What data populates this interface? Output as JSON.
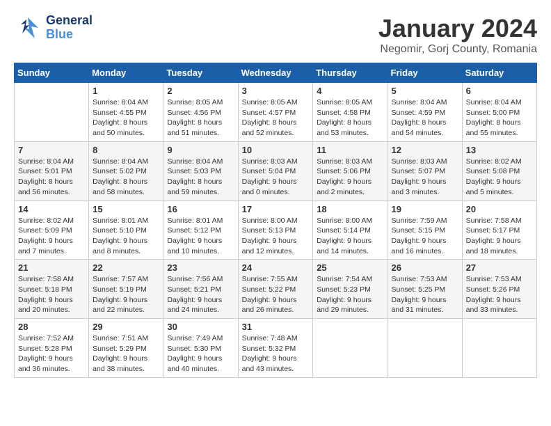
{
  "header": {
    "logo": {
      "general": "General",
      "blue": "Blue"
    },
    "title": "January 2024",
    "location": "Negomir, Gorj County, Romania"
  },
  "weekdays": [
    "Sunday",
    "Monday",
    "Tuesday",
    "Wednesday",
    "Thursday",
    "Friday",
    "Saturday"
  ],
  "weeks": [
    [
      {
        "day": "",
        "sunrise": "",
        "sunset": "",
        "daylight": ""
      },
      {
        "day": "1",
        "sunrise": "Sunrise: 8:04 AM",
        "sunset": "Sunset: 4:55 PM",
        "daylight": "Daylight: 8 hours and 50 minutes."
      },
      {
        "day": "2",
        "sunrise": "Sunrise: 8:05 AM",
        "sunset": "Sunset: 4:56 PM",
        "daylight": "Daylight: 8 hours and 51 minutes."
      },
      {
        "day": "3",
        "sunrise": "Sunrise: 8:05 AM",
        "sunset": "Sunset: 4:57 PM",
        "daylight": "Daylight: 8 hours and 52 minutes."
      },
      {
        "day": "4",
        "sunrise": "Sunrise: 8:05 AM",
        "sunset": "Sunset: 4:58 PM",
        "daylight": "Daylight: 8 hours and 53 minutes."
      },
      {
        "day": "5",
        "sunrise": "Sunrise: 8:04 AM",
        "sunset": "Sunset: 4:59 PM",
        "daylight": "Daylight: 8 hours and 54 minutes."
      },
      {
        "day": "6",
        "sunrise": "Sunrise: 8:04 AM",
        "sunset": "Sunset: 5:00 PM",
        "daylight": "Daylight: 8 hours and 55 minutes."
      }
    ],
    [
      {
        "day": "7",
        "sunrise": "Sunrise: 8:04 AM",
        "sunset": "Sunset: 5:01 PM",
        "daylight": "Daylight: 8 hours and 56 minutes."
      },
      {
        "day": "8",
        "sunrise": "Sunrise: 8:04 AM",
        "sunset": "Sunset: 5:02 PM",
        "daylight": "Daylight: 8 hours and 58 minutes."
      },
      {
        "day": "9",
        "sunrise": "Sunrise: 8:04 AM",
        "sunset": "Sunset: 5:03 PM",
        "daylight": "Daylight: 8 hours and 59 minutes."
      },
      {
        "day": "10",
        "sunrise": "Sunrise: 8:03 AM",
        "sunset": "Sunset: 5:04 PM",
        "daylight": "Daylight: 9 hours and 0 minutes."
      },
      {
        "day": "11",
        "sunrise": "Sunrise: 8:03 AM",
        "sunset": "Sunset: 5:06 PM",
        "daylight": "Daylight: 9 hours and 2 minutes."
      },
      {
        "day": "12",
        "sunrise": "Sunrise: 8:03 AM",
        "sunset": "Sunset: 5:07 PM",
        "daylight": "Daylight: 9 hours and 3 minutes."
      },
      {
        "day": "13",
        "sunrise": "Sunrise: 8:02 AM",
        "sunset": "Sunset: 5:08 PM",
        "daylight": "Daylight: 9 hours and 5 minutes."
      }
    ],
    [
      {
        "day": "14",
        "sunrise": "Sunrise: 8:02 AM",
        "sunset": "Sunset: 5:09 PM",
        "daylight": "Daylight: 9 hours and 7 minutes."
      },
      {
        "day": "15",
        "sunrise": "Sunrise: 8:01 AM",
        "sunset": "Sunset: 5:10 PM",
        "daylight": "Daylight: 9 hours and 8 minutes."
      },
      {
        "day": "16",
        "sunrise": "Sunrise: 8:01 AM",
        "sunset": "Sunset: 5:12 PM",
        "daylight": "Daylight: 9 hours and 10 minutes."
      },
      {
        "day": "17",
        "sunrise": "Sunrise: 8:00 AM",
        "sunset": "Sunset: 5:13 PM",
        "daylight": "Daylight: 9 hours and 12 minutes."
      },
      {
        "day": "18",
        "sunrise": "Sunrise: 8:00 AM",
        "sunset": "Sunset: 5:14 PM",
        "daylight": "Daylight: 9 hours and 14 minutes."
      },
      {
        "day": "19",
        "sunrise": "Sunrise: 7:59 AM",
        "sunset": "Sunset: 5:15 PM",
        "daylight": "Daylight: 9 hours and 16 minutes."
      },
      {
        "day": "20",
        "sunrise": "Sunrise: 7:58 AM",
        "sunset": "Sunset: 5:17 PM",
        "daylight": "Daylight: 9 hours and 18 minutes."
      }
    ],
    [
      {
        "day": "21",
        "sunrise": "Sunrise: 7:58 AM",
        "sunset": "Sunset: 5:18 PM",
        "daylight": "Daylight: 9 hours and 20 minutes."
      },
      {
        "day": "22",
        "sunrise": "Sunrise: 7:57 AM",
        "sunset": "Sunset: 5:19 PM",
        "daylight": "Daylight: 9 hours and 22 minutes."
      },
      {
        "day": "23",
        "sunrise": "Sunrise: 7:56 AM",
        "sunset": "Sunset: 5:21 PM",
        "daylight": "Daylight: 9 hours and 24 minutes."
      },
      {
        "day": "24",
        "sunrise": "Sunrise: 7:55 AM",
        "sunset": "Sunset: 5:22 PM",
        "daylight": "Daylight: 9 hours and 26 minutes."
      },
      {
        "day": "25",
        "sunrise": "Sunrise: 7:54 AM",
        "sunset": "Sunset: 5:23 PM",
        "daylight": "Daylight: 9 hours and 29 minutes."
      },
      {
        "day": "26",
        "sunrise": "Sunrise: 7:53 AM",
        "sunset": "Sunset: 5:25 PM",
        "daylight": "Daylight: 9 hours and 31 minutes."
      },
      {
        "day": "27",
        "sunrise": "Sunrise: 7:53 AM",
        "sunset": "Sunset: 5:26 PM",
        "daylight": "Daylight: 9 hours and 33 minutes."
      }
    ],
    [
      {
        "day": "28",
        "sunrise": "Sunrise: 7:52 AM",
        "sunset": "Sunset: 5:28 PM",
        "daylight": "Daylight: 9 hours and 36 minutes."
      },
      {
        "day": "29",
        "sunrise": "Sunrise: 7:51 AM",
        "sunset": "Sunset: 5:29 PM",
        "daylight": "Daylight: 9 hours and 38 minutes."
      },
      {
        "day": "30",
        "sunrise": "Sunrise: 7:49 AM",
        "sunset": "Sunset: 5:30 PM",
        "daylight": "Daylight: 9 hours and 40 minutes."
      },
      {
        "day": "31",
        "sunrise": "Sunrise: 7:48 AM",
        "sunset": "Sunset: 5:32 PM",
        "daylight": "Daylight: 9 hours and 43 minutes."
      },
      {
        "day": "",
        "sunrise": "",
        "sunset": "",
        "daylight": ""
      },
      {
        "day": "",
        "sunrise": "",
        "sunset": "",
        "daylight": ""
      },
      {
        "day": "",
        "sunrise": "",
        "sunset": "",
        "daylight": ""
      }
    ]
  ]
}
